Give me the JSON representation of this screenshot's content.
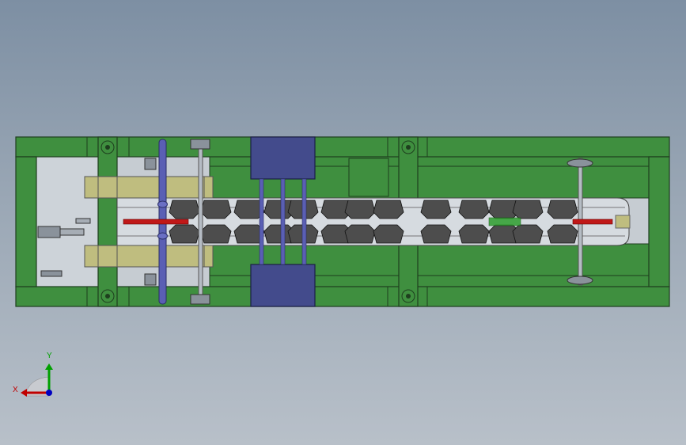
{
  "viewport": {
    "background_top": "#7d8fa3",
    "background_bottom": "#b8c0c9"
  },
  "colors": {
    "frame": "#3f8f3f",
    "frame_edge": "#1e3e1e",
    "guide_plate": "#bfbd7f",
    "cylinder_block": "#434b8c",
    "rod": "#5a5fb4",
    "die_block": "#4d4d4d",
    "red_mark": "#c01818",
    "green_mark": "#2e9e2e",
    "floor": "#c6ccd2"
  },
  "triad": {
    "x_label": "X",
    "y_label": "Y",
    "x_color": "#c00000",
    "y_color": "#00a000",
    "z_color": "#0000c0"
  }
}
